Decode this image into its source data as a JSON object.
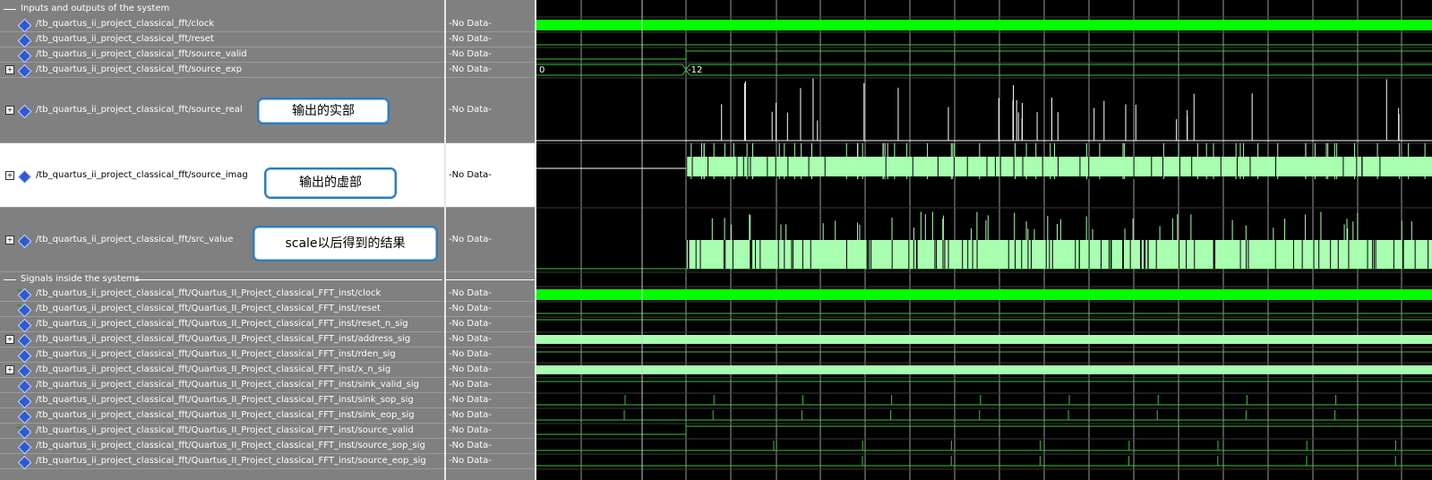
{
  "groups": {
    "io": "Inputs and outputs of the system",
    "inside": "Signals inside the systems"
  },
  "signals_io": [
    {
      "name": "/tb_quartus_ii_project_classical_fft/clock",
      "value": "-No Data-",
      "expandable": false
    },
    {
      "name": "/tb_quartus_ii_project_classical_fft/reset",
      "value": "-No Data-",
      "expandable": false
    },
    {
      "name": "/tb_quartus_ii_project_classical_fft/source_valid",
      "value": "-No Data-",
      "expandable": false
    },
    {
      "name": "/tb_quartus_ii_project_classical_fft/source_exp",
      "value": "-No Data-",
      "expandable": true
    },
    {
      "name": "/tb_quartus_ii_project_classical_fft/source_real",
      "value": "-No Data-",
      "expandable": true
    },
    {
      "name": "/tb_quartus_ii_project_classical_fft/source_imag",
      "value": "-No Data-",
      "expandable": true
    },
    {
      "name": "/tb_quartus_ii_project_classical_fft/src_value",
      "value": "-No Data-",
      "expandable": true
    }
  ],
  "signals_inside": [
    {
      "name": "/tb_quartus_ii_project_classical_fft/Quartus_II_Project_classical_FFT_inst/clock",
      "value": "-No Data-",
      "expandable": false
    },
    {
      "name": "/tb_quartus_ii_project_classical_fft/Quartus_II_Project_classical_FFT_inst/reset",
      "value": "-No Data-",
      "expandable": false
    },
    {
      "name": "/tb_quartus_ii_project_classical_fft/Quartus_II_Project_classical_FFT_inst/reset_n_sig",
      "value": "-No Data-",
      "expandable": false
    },
    {
      "name": "/tb_quartus_ii_project_classical_fft/Quartus_II_Project_classical_FFT_inst/address_sig",
      "value": "-No Data-",
      "expandable": true
    },
    {
      "name": "/tb_quartus_ii_project_classical_fft/Quartus_II_Project_classical_FFT_inst/rden_sig",
      "value": "-No Data-",
      "expandable": false
    },
    {
      "name": "/tb_quartus_ii_project_classical_fft/Quartus_II_Project_classical_FFT_inst/x_n_sig",
      "value": "-No Data-",
      "expandable": true
    },
    {
      "name": "/tb_quartus_ii_project_classical_fft/Quartus_II_Project_classical_FFT_inst/sink_valid_sig",
      "value": "-No Data-",
      "expandable": false
    },
    {
      "name": "/tb_quartus_ii_project_classical_fft/Quartus_II_Project_classical_FFT_inst/sink_sop_sig",
      "value": "-No Data-",
      "expandable": false
    },
    {
      "name": "/tb_quartus_ii_project_classical_fft/Quartus_II_Project_classical_FFT_inst/sink_eop_sig",
      "value": "-No Data-",
      "expandable": false
    },
    {
      "name": "/tb_quartus_ii_project_classical_fft/Quartus_II_Project_classical_FFT_inst/source_valid",
      "value": "-No Data-",
      "expandable": false
    },
    {
      "name": "/tb_quartus_ii_project_classical_fft/Quartus_II_Project_classical_FFT_inst/source_sop_sig",
      "value": "-No Data-",
      "expandable": false
    },
    {
      "name": "/tb_quartus_ii_project_classical_fft/Quartus_II_Project_classical_FFT_inst/source_eop_sig",
      "value": "-No Data-",
      "expandable": false
    }
  ],
  "annotations": {
    "real": "输出的实部",
    "imag": "输出的虚部",
    "scale": "scale以后得到的结果"
  },
  "bus_values": {
    "exp_before": "0",
    "exp_after": "-12"
  },
  "colors": {
    "panel_bg": "#808080",
    "wave_bg": "#000000",
    "wave_green": "#00ff00",
    "wave_light": "#a8ffb0",
    "wave_line": "#39c439",
    "grid": "#9a9a9a",
    "cursor": "#c0c0c0",
    "note_border": "#2a7cc1"
  }
}
